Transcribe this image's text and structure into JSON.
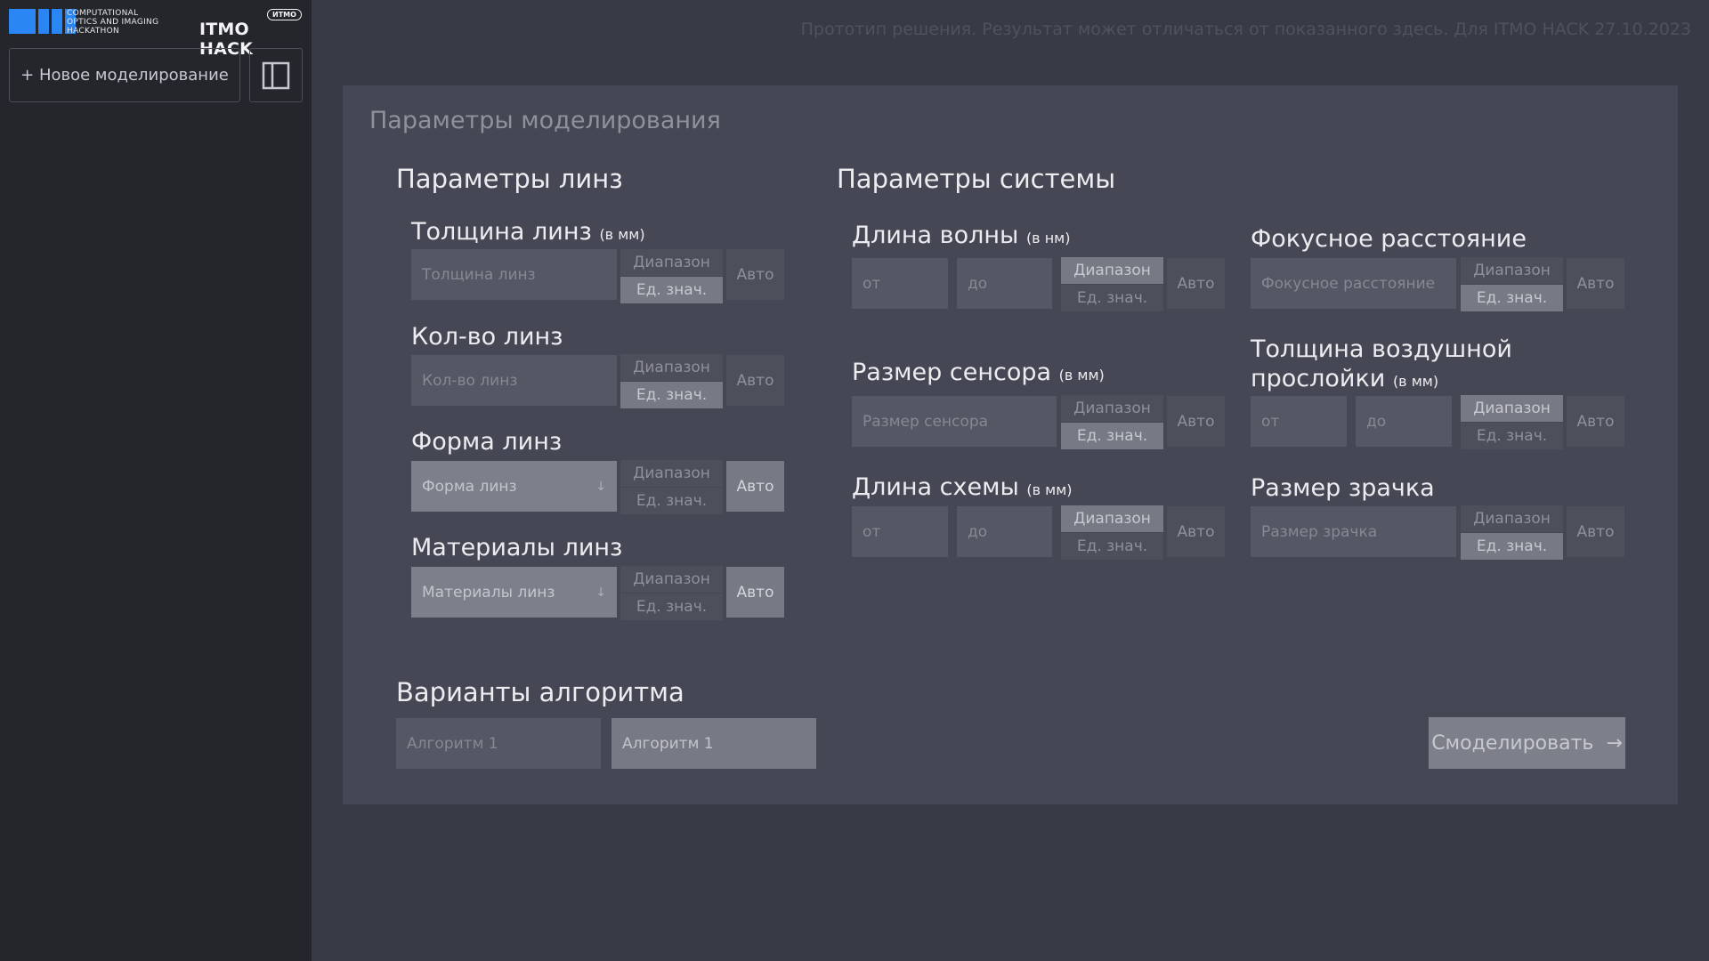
{
  "app": {
    "logo_text": [
      "COMPUTATIONAL",
      "OPTICS AND IMAGING",
      "HACKATHON"
    ],
    "logo_itmo": "ITMO HACK",
    "logo_badge": "ИТМО",
    "brand_color": "#2a86f2"
  },
  "sidebar": {
    "new_label": "+ Новое моделирование",
    "panel_icon": "sidebar-panel-icon"
  },
  "header": {
    "note": "Прототип решения. Результат может отличаться от показанного здесь. Для ITMO HACK 27.10.2023"
  },
  "card": {
    "title": "Параметры моделирования",
    "lens_section": "Параметры линз",
    "system_section": "Параметры системы",
    "algo_section": "Варианты алгоритма"
  },
  "segments": {
    "range": "Диапазон",
    "single": "Ед. знач.",
    "auto": "Авто"
  },
  "lens": {
    "thickness": {
      "label": "Толщина линз",
      "unit": "(в мм)",
      "placeholder": "Толщина линз",
      "mode": "single"
    },
    "count": {
      "label": "Кол-во линз",
      "placeholder": "Кол-во линз",
      "mode": "single"
    },
    "shape": {
      "label": "Форма линз",
      "placeholder": "Форма линз",
      "mode": "auto"
    },
    "materials": {
      "label": "Материалы линз",
      "placeholder": "Материалы линз",
      "mode": "auto"
    }
  },
  "system": {
    "wavelength": {
      "label": "Длина волны",
      "unit": "(в нм)",
      "from": "от",
      "to": "до",
      "mode": "range"
    },
    "sensor": {
      "label": "Размер сенсора",
      "unit": "(в мм)",
      "placeholder": "Размер сенсора",
      "mode": "single"
    },
    "scheme_length": {
      "label": "Длина схемы",
      "unit": "(в мм)",
      "from": "от",
      "to": "до",
      "mode": "range"
    },
    "focal": {
      "label": "Фокусное расстояние",
      "placeholder": "Фокусное расстояние",
      "mode": "single"
    },
    "air_gap": {
      "label_line1": "Толщина воздушной",
      "label_line2": "прослойки",
      "unit": "(в мм)",
      "from": "от",
      "to": "до",
      "mode": "range"
    },
    "pupil": {
      "label": "Размер зрачка",
      "placeholder": "Размер зрачка",
      "mode": "single"
    }
  },
  "algorithm": {
    "option1": "Алгоритм 1",
    "option2": "Алгоритм 1",
    "selected_index": 1
  },
  "submit": {
    "label": "Смоделировать",
    "arrow": "→"
  }
}
